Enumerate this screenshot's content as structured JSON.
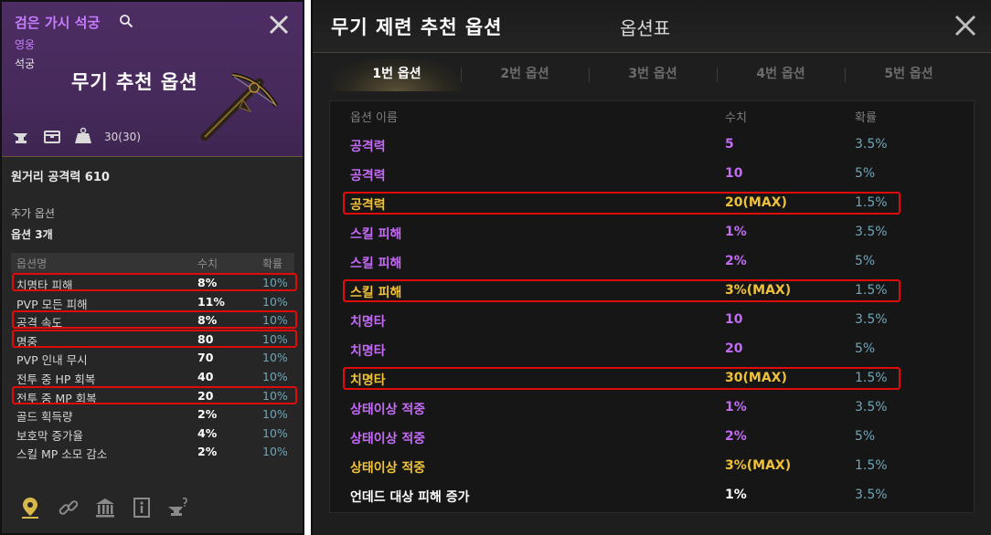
{
  "left_panel": {
    "item_name": "검은 가시 석궁",
    "grade": "영웅",
    "weapon_type": "석궁",
    "overlay_title": "무기 추천 옵션",
    "durability": "30(30)",
    "attack_line": "원거리 공격력 610",
    "extra_options_label": "추가 옵션",
    "option_count": "옵션 3개",
    "table_headers": {
      "name": "옵션명",
      "value": "수치",
      "probability": "확률"
    },
    "rows": [
      {
        "name": "치명타 피해",
        "value": "8%",
        "probability": "10%",
        "highlighted": true
      },
      {
        "name": "PVP 모든 피해",
        "value": "11%",
        "probability": "10%",
        "highlighted": false
      },
      {
        "name": "공격 속도",
        "value": "8%",
        "probability": "10%",
        "highlighted": true
      },
      {
        "name": "명중",
        "value": "80",
        "probability": "10%",
        "highlighted": true
      },
      {
        "name": "PVP 인내 무시",
        "value": "70",
        "probability": "10%",
        "highlighted": false
      },
      {
        "name": "전투 중 HP 회복",
        "value": "40",
        "probability": "10%",
        "highlighted": false
      },
      {
        "name": "전투 중 MP 회복",
        "value": "20",
        "probability": "10%",
        "highlighted": true
      },
      {
        "name": "골드 획득량",
        "value": "2%",
        "probability": "10%",
        "highlighted": false
      },
      {
        "name": "보호막 증가율",
        "value": "4%",
        "probability": "10%",
        "highlighted": false
      },
      {
        "name": "스킬 MP 소모 감소",
        "value": "2%",
        "probability": "10%",
        "highlighted": false
      }
    ],
    "icons": [
      "search-icon",
      "close-icon",
      "anvil-icon",
      "chest-icon",
      "weight-icon",
      "location-pin-icon",
      "link-icon",
      "bank-icon",
      "info-card-icon",
      "anvil-question-icon"
    ]
  },
  "right_panel": {
    "overlay_title": "무기 제련 추천 옵션",
    "window_title": "옵션표",
    "tabs": [
      "1번 옵션",
      "2번 옵션",
      "3번 옵션",
      "4번 옵션",
      "5번 옵션"
    ],
    "active_tab": "1번 옵션",
    "table_headers": {
      "name": "옵션 이름",
      "value": "수치",
      "probability": "확률"
    },
    "rows": [
      {
        "name": "공격력",
        "value": "5",
        "probability": "3.5%",
        "tier": "epic"
      },
      {
        "name": "공격력",
        "value": "10",
        "probability": "5%",
        "tier": "epic"
      },
      {
        "name": "공격력",
        "value": "20(MAX)",
        "probability": "1.5%",
        "tier": "max",
        "highlighted": true
      },
      {
        "name": "스킬 피해",
        "value": "1%",
        "probability": "3.5%",
        "tier": "epic"
      },
      {
        "name": "스킬 피해",
        "value": "2%",
        "probability": "5%",
        "tier": "epic"
      },
      {
        "name": "스킬 피해",
        "value": "3%(MAX)",
        "probability": "1.5%",
        "tier": "max",
        "highlighted": true
      },
      {
        "name": "치명타",
        "value": "10",
        "probability": "3.5%",
        "tier": "epic"
      },
      {
        "name": "치명타",
        "value": "20",
        "probability": "5%",
        "tier": "epic"
      },
      {
        "name": "치명타",
        "value": "30(MAX)",
        "probability": "1.5%",
        "tier": "max",
        "highlighted": true
      },
      {
        "name": "상태이상 적중",
        "value": "1%",
        "probability": "3.5%",
        "tier": "epic"
      },
      {
        "name": "상태이상 적중",
        "value": "2%",
        "probability": "5%",
        "tier": "epic"
      },
      {
        "name": "상태이상 적중",
        "value": "3%(MAX)",
        "probability": "1.5%",
        "tier": "max"
      },
      {
        "name": "언데드 대상 피해 증가",
        "value": "1%",
        "probability": "3.5%",
        "tier": "normal"
      }
    ]
  },
  "colors": {
    "epic": "#c36bf5",
    "max": "#f0c23a",
    "normal": "#ffffff",
    "probability": "#6fa6b8",
    "highlight_border": "#e10b0b"
  }
}
